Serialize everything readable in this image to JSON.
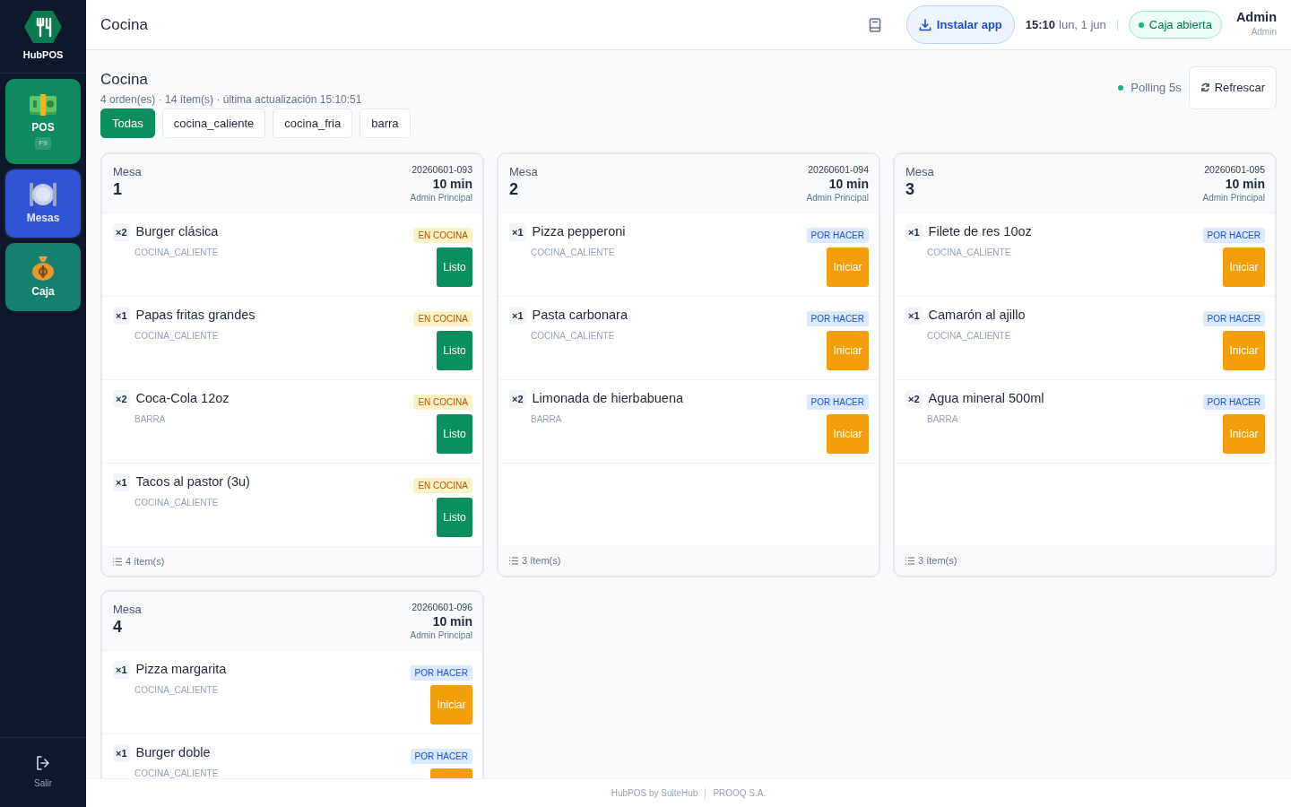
{
  "sidebar": {
    "brand": "HubPOS",
    "items": [
      {
        "label": "POS",
        "shortcut": "F9",
        "kind": "money",
        "color": "#0e8a5f",
        "selected": false
      },
      {
        "label": "Mesas",
        "kind": "plate",
        "color": "#2f55d4",
        "selected": true
      },
      {
        "label": "Caja",
        "kind": "bag",
        "color": "#14806d",
        "selected": false
      }
    ],
    "logout": "Salir"
  },
  "header": {
    "title": "Cocina",
    "install_button": "Instalar app",
    "time": "15:10",
    "date": "lun, 1 jun",
    "cash_status": "Caja abierta",
    "user_name": "Admin",
    "user_role": "Admin"
  },
  "page": {
    "title": "Cocina",
    "subtitle": "4 orden(es) · 14 ítem(s) · última actualización 15:10:51",
    "polling": "Polling 5s",
    "refresh_button": "Refrescar"
  },
  "filters": [
    {
      "label": "Todas",
      "selected": true
    },
    {
      "label": "cocina_caliente",
      "selected": false
    },
    {
      "label": "cocina_fria",
      "selected": false
    },
    {
      "label": "barra",
      "selected": false
    }
  ],
  "orders": [
    {
      "table_label": "Mesa",
      "table": "1",
      "code": "20260601-093",
      "elapsed": "10 min",
      "waiter": "Admin Principal",
      "footer": "4 ítem(s)",
      "items": [
        {
          "qty": "×2",
          "name": "Burger clásica",
          "station": "COCINA_CALIENTE",
          "kind": "cooking",
          "status_label": "EN COCINA",
          "action": "Listo"
        },
        {
          "qty": "×1",
          "name": "Papas fritas grandes",
          "station": "COCINA_CALIENTE",
          "kind": "cooking",
          "status_label": "EN COCINA",
          "action": "Listo"
        },
        {
          "qty": "×2",
          "name": "Coca-Cola 12oz",
          "station": "BARRA",
          "kind": "cooking",
          "status_label": "EN COCINA",
          "action": "Listo"
        },
        {
          "qty": "×1",
          "name": "Tacos al pastor (3u)",
          "station": "COCINA_CALIENTE",
          "kind": "cooking",
          "status_label": "EN COCINA",
          "action": "Listo"
        }
      ]
    },
    {
      "table_label": "Mesa",
      "table": "2",
      "code": "20260601-094",
      "elapsed": "10 min",
      "waiter": "Admin Principal",
      "footer": "3 ítem(s)",
      "items": [
        {
          "qty": "×1",
          "name": "Pizza pepperoni",
          "station": "COCINA_CALIENTE",
          "kind": "todo",
          "status_label": "POR HACER",
          "action": "Iniciar"
        },
        {
          "qty": "×1",
          "name": "Pasta carbonara",
          "station": "COCINA_CALIENTE",
          "kind": "todo",
          "status_label": "POR HACER",
          "action": "Iniciar"
        },
        {
          "qty": "×2",
          "name": "Limonada de hierbabuena",
          "station": "BARRA",
          "kind": "todo",
          "status_label": "POR HACER",
          "action": "Iniciar"
        }
      ]
    },
    {
      "table_label": "Mesa",
      "table": "3",
      "code": "20260601-095",
      "elapsed": "10 min",
      "waiter": "Admin Principal",
      "footer": "3 ítem(s)",
      "items": [
        {
          "qty": "×1",
          "name": "Filete de res 10oz",
          "station": "COCINA_CALIENTE",
          "kind": "todo",
          "status_label": "POR HACER",
          "action": "Iniciar"
        },
        {
          "qty": "×1",
          "name": "Camarón al ajillo",
          "station": "COCINA_CALIENTE",
          "kind": "todo",
          "status_label": "POR HACER",
          "action": "Iniciar"
        },
        {
          "qty": "×2",
          "name": "Agua mineral 500ml",
          "station": "BARRA",
          "kind": "todo",
          "status_label": "POR HACER",
          "action": "Iniciar"
        }
      ]
    },
    {
      "table_label": "Mesa",
      "table": "4",
      "code": "20260601-096",
      "elapsed": "10 min",
      "waiter": "Admin Principal",
      "items": [
        {
          "qty": "×1",
          "name": "Pizza margarita",
          "station": "COCINA_CALIENTE",
          "kind": "todo",
          "status_label": "POR HACER",
          "action": "Iniciar"
        },
        {
          "qty": "×1",
          "name": "Burger doble",
          "station": "COCINA_CALIENTE",
          "kind": "todo",
          "status_label": "POR HACER"
        }
      ]
    }
  ],
  "footer": {
    "left": "HubPOS by SuiteHub",
    "right": "PROOQ S.A."
  }
}
